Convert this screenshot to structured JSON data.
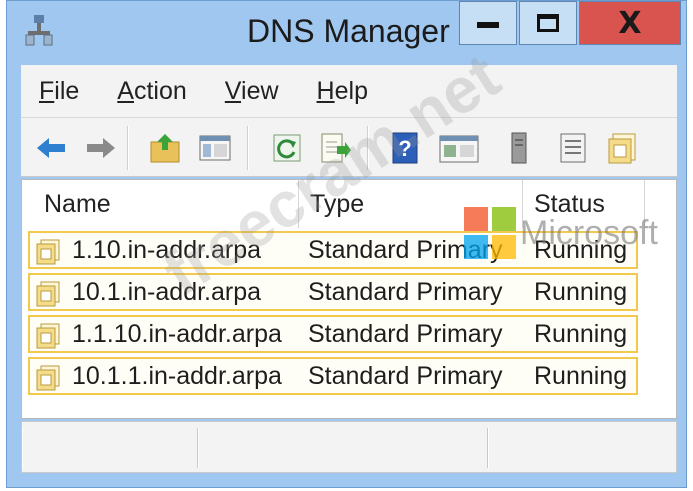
{
  "window": {
    "title": "DNS Manager",
    "minimize_glyph": "minimize",
    "maximize_glyph": "maximize",
    "close_label": "X"
  },
  "menu": [
    "File",
    "Action",
    "View",
    "Help"
  ],
  "toolbar": {
    "icons": [
      "back-icon",
      "forward-icon",
      "up-folder-icon",
      "show-hide-tree-icon",
      "refresh-icon",
      "export-list-icon",
      "help-icon",
      "properties-icon",
      "server-icon",
      "list-icon",
      "zone-icon"
    ]
  },
  "list": {
    "columns": [
      "Name",
      "Type",
      "Status"
    ],
    "rows": [
      {
        "name": "1.10.in-addr.arpa",
        "type": "Standard Primary",
        "status": "Running"
      },
      {
        "name": "10.1.in-addr.arpa",
        "type": "Standard Primary",
        "status": "Running"
      },
      {
        "name": "1.1.10.in-addr.arpa",
        "type": "Standard Primary",
        "status": "Running"
      },
      {
        "name": "10.1.1.in-addr.arpa",
        "type": "Standard Primary",
        "status": "Running"
      }
    ]
  },
  "watermarks": {
    "microsoft": "Microsoft",
    "freecram": "freecram.net"
  },
  "colors": {
    "titlebar": "#9fc7ef",
    "close_button": "#d9534f",
    "row_highlight_border": "#f2c94c"
  }
}
